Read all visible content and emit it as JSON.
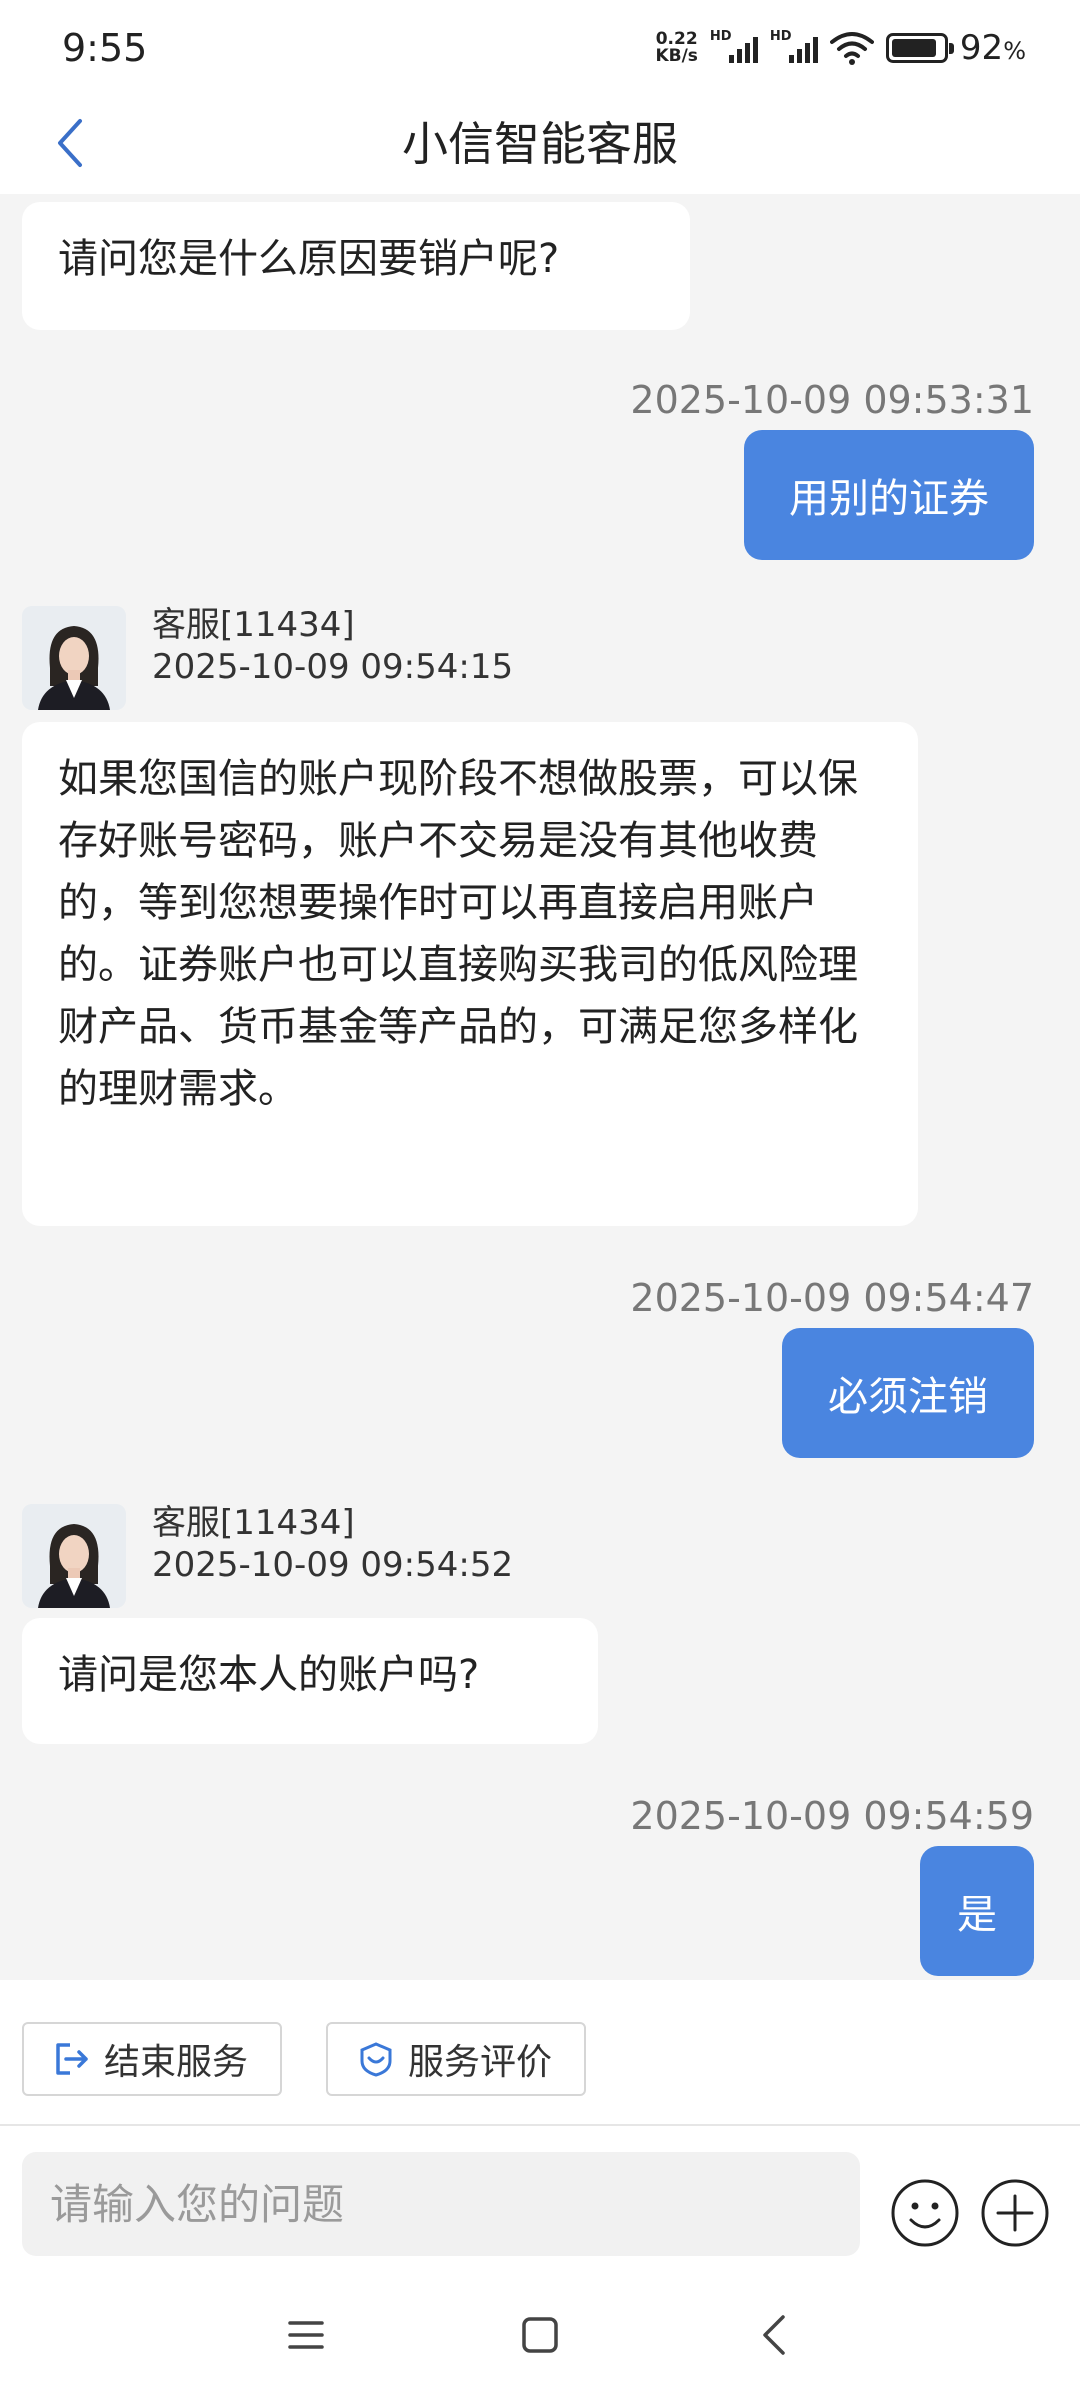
{
  "status_bar": {
    "time": "9:55",
    "net_speed_value": "0.22",
    "net_speed_unit": "KB/s",
    "sim1_label": "HD",
    "sim2_label": "HD",
    "battery_percent": "92",
    "battery_unit": "%"
  },
  "header": {
    "title": "小信智能客服",
    "back_icon": "chevron-left-icon"
  },
  "messages": [
    {
      "side": "left",
      "text": "请问您是什么原因要销户呢?"
    },
    {
      "side": "right",
      "timestamp": "2025-10-09 09:53:31",
      "text": "用别的证券"
    },
    {
      "side": "left",
      "agent": "客服[11434]",
      "timestamp": "2025-10-09 09:54:15",
      "text": "如果您国信的账户现阶段不想做股票，可以保存好账号密码，账户不交易是没有其他收费的，等到您想要操作时可以再直接启用账户的。证券账户也可以直接购买我司的低风险理财产品、货币基金等产品的，可满足您多样化的理财需求。"
    },
    {
      "side": "right",
      "timestamp": "2025-10-09 09:54:47",
      "text": "必须注销"
    },
    {
      "side": "left",
      "agent": "客服[11434]",
      "timestamp": "2025-10-09 09:54:52",
      "text": "请问是您本人的账户吗?"
    },
    {
      "side": "right",
      "timestamp": "2025-10-09 09:54:59",
      "text": "是"
    }
  ],
  "actions": {
    "end_service_label": "结束服务",
    "end_service_icon": "exit-icon",
    "rate_service_label": "服务评价",
    "rate_service_icon": "rating-shield-icon"
  },
  "composer": {
    "placeholder": "请输入您的问题",
    "value": "",
    "emoji_icon": "emoji-icon",
    "plus_icon": "plus-icon"
  },
  "colors": {
    "accent": "#4a85e0",
    "chat_background": "#f4f4f4",
    "bubble_left": "#ffffff"
  }
}
